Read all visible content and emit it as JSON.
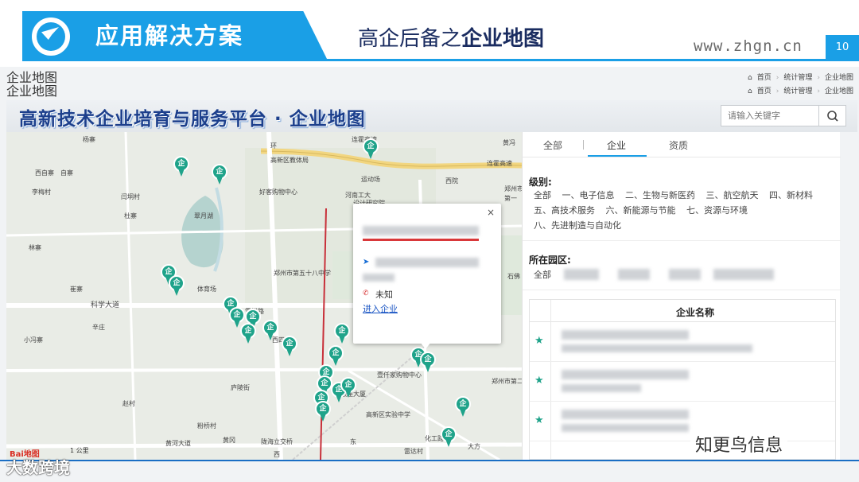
{
  "slide": {
    "title": "应用解决方案",
    "subtitle_plain": "高企后备之",
    "subtitle_bold": "企业地图",
    "url": "www.zhgn.cn",
    "page_number": "10",
    "brand_color": "#1a9fe6"
  },
  "app": {
    "page_title_a": "企业地图",
    "page_title_b": "企业地图",
    "breadcrumb": [
      "首页",
      "统计管理",
      "企业地图"
    ],
    "banner_title": "高新技术企业培育与服务平台 · 企业地图",
    "search_placeholder": "请输入关键字",
    "search_icon": "search-icon"
  },
  "map": {
    "labels": [
      "杨寨",
      "西自寨",
      "自寨",
      "李梅村",
      "闫垌村",
      "杜寨",
      "林寨",
      "崔寨",
      "科学大道",
      "辛庄",
      "小冯寨",
      "赵村",
      "庐陵街",
      "大方",
      "翠月湖",
      "高新区教体局",
      "好客购物中心",
      "运动场",
      "河南工大",
      "设计研究院",
      "西院",
      "郑州市",
      "第一",
      "环",
      "连霍高速",
      "连霍高速",
      "黄冯",
      "郑州市第五十八中学",
      "体育场",
      "雪松路",
      "西四环",
      "壹仟家购物中心",
      "高新区实验中学",
      "银座大厦",
      "化工路",
      "黄冈",
      "粉桥村",
      "黄河大道",
      "陇海立交桥",
      "东",
      "雷达村",
      "西",
      "郑州市第二十七中学",
      "石佛"
    ],
    "scale_label": "1 公里",
    "baidu_logo": "Bai地图",
    "pin_char": "企",
    "pin_color": "#1fa38a",
    "popup": {
      "phone": "未知",
      "enter_link": "进入企业",
      "close": "×"
    }
  },
  "panel": {
    "tabs": [
      "全部",
      "企业",
      "资质"
    ],
    "active_tab": "企业",
    "level_label": "级别:",
    "levels": [
      "全部",
      "一、电子信息",
      "二、生物与新医药",
      "三、航空航天",
      "四、新材料",
      "五、高技术服务",
      "六、新能源与节能",
      "七、资源与环境",
      "八、先进制造与自动化"
    ],
    "park_label": "所在园区:",
    "parks_all": "全部",
    "table_header": "企业名称",
    "star": "★"
  },
  "footer": {
    "watermark_left": "大数跨境",
    "watermark_right": "知更鸟信息"
  }
}
